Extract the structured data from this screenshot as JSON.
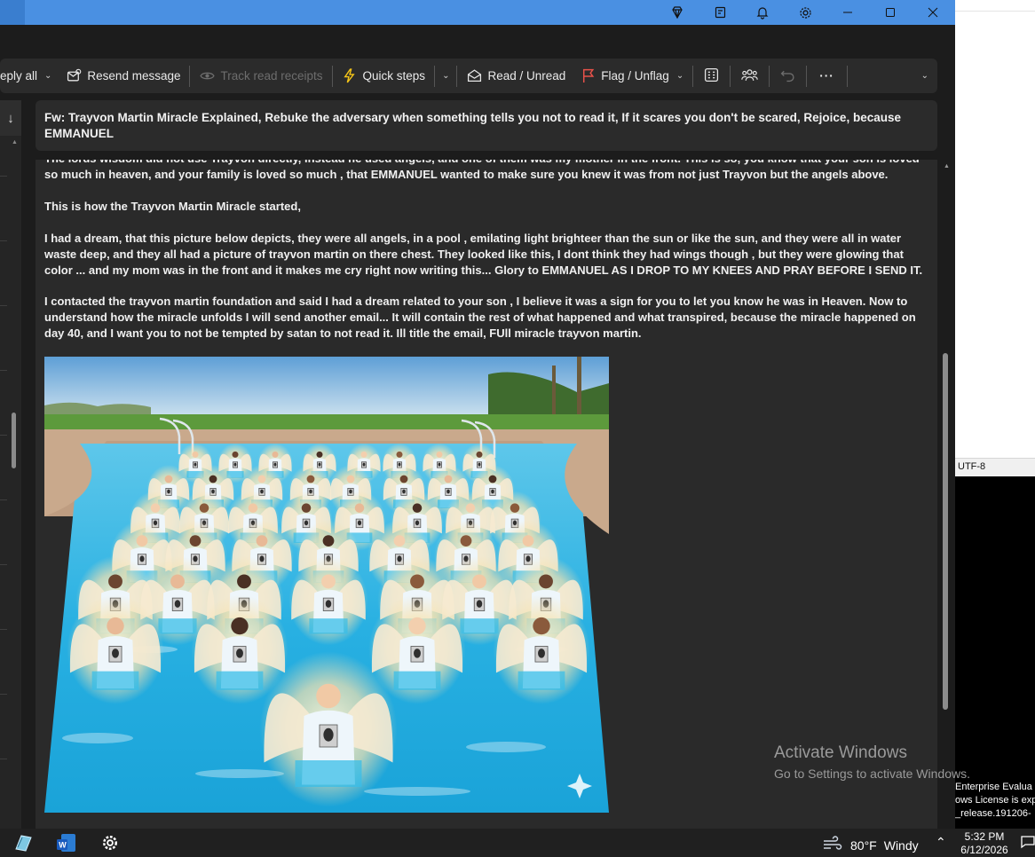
{
  "ribbon": {
    "reply_all": "eply all",
    "resend": "Resend message",
    "track": "Track read receipts",
    "quick_steps": "Quick steps",
    "read_unread": "Read / Unread",
    "flag": "Flag / Unflag"
  },
  "email": {
    "subject": "Fw: Trayvon Martin Miracle Explained, Rebuke the adversary when something tells you not to read it, If it scares you don't be scared, Rejoice, because EMMANUEL",
    "p0": "The lords wisdom did not use Trayvon directly, instead he used angels, and one of them was my mother in the front. This is so, you know that your son is loved so much in heaven, and your family is loved so much , that EMMANUEL wanted to make sure you knew it was from not just Trayvon but the angels above.",
    "p1": "This is how the Trayvon Martin Miracle started,",
    "p2": "I had a dream, that this picture below depicts, they were all angels, in a pool , emilating light brighteer than the sun or like the sun, and they were all in water waste deep, and they all had a picture of trayvon martin on there chest.  They looked like this, I dont think they had wings though , but they were glowing that color ... and my mom was in the front and it makes me cry right now writing this... Glory to EMMANUEL AS I DROP TO MY KNEES AND PRAY BEFORE I SEND IT.",
    "p3": " I contacted the trayvon martin foundation and said I had a dream related to your son , I believe it was a sign for you to let you know he was in Heaven.  Now to understand how the miracle unfolds I will send another email... It will contain the rest of what happened and what transpired, because the miracle happened on day 40, and I want you to not be tempted by satan to not read it. Ill title the email, FUll miracle trayvon martin."
  },
  "status": {
    "encoding": "UTF-8"
  },
  "console_lines": [
    "Enterprise Evalua",
    "ows License is exp",
    "_release.191206-"
  ],
  "watermark": {
    "title": "Activate Windows",
    "subtitle": "Go to Settings to activate Windows."
  },
  "taskbar": {
    "temp": "80°F",
    "condition": "Windy",
    "time": "5:32 PM",
    "date": "6/12/2026"
  },
  "colors": {
    "titlebar": "#4a90e2",
    "flag": "#e8524a",
    "quick_steps": "#f5c518"
  }
}
